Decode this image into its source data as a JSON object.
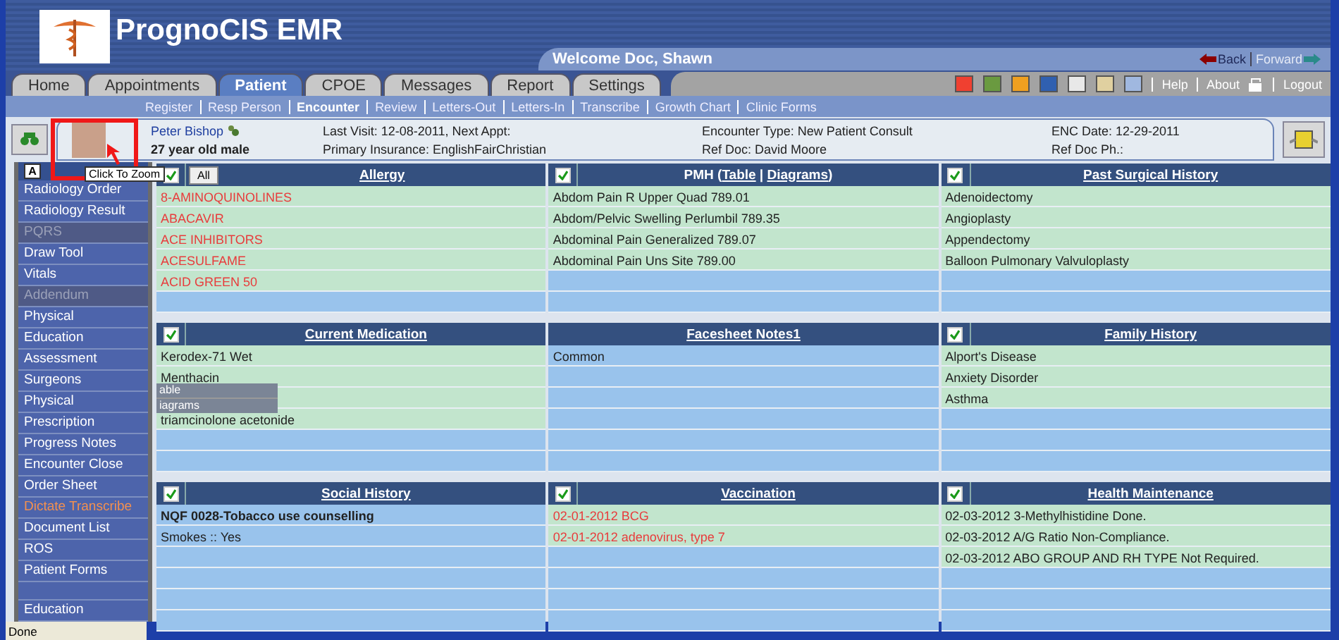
{
  "app": {
    "title": "PrognoCIS EMR",
    "welcome": "Welcome Doc, Shawn"
  },
  "history_nav": [
    {
      "label": "Back",
      "disabled": false
    },
    {
      "label": "Forward",
      "disabled": true
    }
  ],
  "tabs": [
    {
      "label": "Home",
      "selected": false
    },
    {
      "label": "Appointments",
      "selected": false
    },
    {
      "label": "Patient",
      "selected": true
    },
    {
      "label": "CPOE",
      "selected": false
    },
    {
      "label": "Messages",
      "selected": false
    },
    {
      "label": "Report",
      "selected": false
    },
    {
      "label": "Settings",
      "selected": false
    }
  ],
  "toolbar_links": [
    "Help",
    "About"
  ],
  "logout": "Logout",
  "subnav": [
    {
      "label": "Register",
      "selected": false
    },
    {
      "label": "Resp Person",
      "selected": false
    },
    {
      "label": "Encounter",
      "selected": true
    },
    {
      "label": "Review",
      "selected": false
    },
    {
      "label": "Letters-Out",
      "selected": false
    },
    {
      "label": "Letters-In",
      "selected": false
    },
    {
      "label": "Transcribe",
      "selected": false
    },
    {
      "label": "Growth Chart",
      "selected": false
    },
    {
      "label": "Clinic Forms",
      "selected": false
    }
  ],
  "patient": {
    "name": "Peter Bishop",
    "summary": "27 year old male",
    "fields": [
      [
        "Last Visit: 12-08-2011, Next Appt:",
        "Primary Insurance: EnglishFairChristian"
      ],
      [
        "Encounter Type: New Patient Consult",
        "Ref Doc: David Moore"
      ],
      [
        "ENC Date: 12-29-2011",
        "Ref Doc Ph.:"
      ]
    ]
  },
  "sidebar": {
    "scroll_button": "A",
    "items": [
      {
        "label": "Radiology Order",
        "kind": "link"
      },
      {
        "label": "Radiology Result",
        "kind": "link"
      },
      {
        "label": "PQRS",
        "kind": "group"
      },
      {
        "label": "Draw Tool",
        "kind": "link"
      },
      {
        "label": "Vitals",
        "kind": "link"
      },
      {
        "label": "Addendum",
        "kind": "group"
      },
      {
        "label": "Physical",
        "kind": "link"
      },
      {
        "label": "Education",
        "kind": "link"
      },
      {
        "label": "Assessment",
        "kind": "link"
      },
      {
        "label": "Surgeons",
        "kind": "link"
      },
      {
        "label": "Physical",
        "kind": "link"
      },
      {
        "label": "Prescription",
        "kind": "link"
      },
      {
        "label": "Progress Notes",
        "kind": "link"
      },
      {
        "label": "Encounter Close",
        "kind": "link"
      },
      {
        "label": "Order Sheet",
        "kind": "link"
      },
      {
        "label": "Dictate Transcribe",
        "kind": "alert"
      },
      {
        "label": "Document List",
        "kind": "link"
      },
      {
        "label": "ROS",
        "kind": "link"
      },
      {
        "label": "Patient Forms",
        "kind": "link"
      },
      {
        "kind": "spacer"
      },
      {
        "label": "Education",
        "kind": "link"
      }
    ]
  },
  "panels": [
    {
      "title": [
        {
          "text": "Allergy",
          "link": true
        }
      ],
      "checked": true,
      "all_button": "All",
      "alert": true,
      "shaded": true,
      "rows": [
        {
          "text": "8-AMINOQUINOLINES"
        },
        {
          "text": "ABACAVIR"
        },
        {
          "text": "ACE INHIBITORS"
        },
        {
          "text": "ACESULFAME"
        },
        {
          "text": "ACID GREEN 50"
        }
      ]
    },
    {
      "title": [
        {
          "text": "PMH (",
          "link": false
        },
        {
          "text": "Table",
          "link": true
        },
        {
          "text": " | ",
          "link": false
        },
        {
          "text": "Diagrams",
          "link": true
        },
        {
          "text": ")",
          "link": false
        }
      ],
      "checked": true,
      "alert": false,
      "shaded": true,
      "rows": [
        {
          "text": "Abdom Pain R Upper Quad 789.01"
        },
        {
          "text": "Abdom/Pelvic Swelling Perlumbil 789.35"
        },
        {
          "text": "Abdominal Pain Generalized 789.07"
        },
        {
          "text": "Abdominal Pain Uns Site 789.00"
        }
      ]
    },
    {
      "title": [
        {
          "text": "Past Surgical History",
          "link": true
        }
      ],
      "checked": true,
      "alert": false,
      "shaded": true,
      "rows": [
        {
          "text": "Adenoidectomy"
        },
        {
          "text": "Angioplasty"
        },
        {
          "text": "Appendectomy"
        },
        {
          "text": "Balloon Pulmonary Valvuloplasty"
        }
      ]
    },
    {
      "title": [
        {
          "text": "Current Medication",
          "link": true
        }
      ],
      "checked": true,
      "alert": false,
      "shaded": true,
      "rows": [
        {
          "text": "Kerodex-71 Wet"
        },
        {
          "text": "Menthacin"
        },
        {},
        {
          "text": "triamcinolone acetonide"
        }
      ]
    },
    {
      "title": [
        {
          "text": "Facesheet Notes1",
          "link": true
        }
      ],
      "alert": false,
      "shaded": false,
      "rows": [
        {
          "text": "Common"
        }
      ]
    },
    {
      "title": [
        {
          "text": "Family History",
          "link": true
        }
      ],
      "checked": true,
      "alert": false,
      "shaded": true,
      "rows": [
        {
          "text": "Alport's Disease"
        },
        {
          "text": "Anxiety Disorder"
        },
        {
          "text": "Asthma"
        }
      ]
    },
    {
      "title": [
        {
          "text": "Social History",
          "link": true
        }
      ],
      "checked": true,
      "alert": false,
      "shaded": false,
      "rows": [
        {
          "text": "NQF 0028-Tobacco use counselling",
          "bold": true
        },
        {
          "text": "Smokes :: Yes",
          "bold": false
        }
      ]
    },
    {
      "title": [
        {
          "text": "Vaccination",
          "link": true
        }
      ],
      "checked": true,
      "alert": true,
      "shaded": true,
      "rows": [
        {
          "text": "02-01-2012 BCG"
        },
        {
          "text": "02-01-2012 adenovirus, type 7"
        }
      ]
    },
    {
      "title": [
        {
          "text": "Health Maintenance",
          "link": true
        }
      ],
      "checked": true,
      "alert": false,
      "shaded": true,
      "rows": [
        {
          "text": "02-03-2012 3-Methylhistidine Done."
        },
        {
          "text": "02-03-2012 A/G Ratio Non-Compliance."
        },
        {
          "text": "02-03-2012 ABO GROUP AND RH TYPE Not Required."
        }
      ]
    }
  ],
  "tooltip": "Click To Zoom",
  "popup_menu": [
    "able",
    "iagrams"
  ],
  "status_bar": "Done"
}
